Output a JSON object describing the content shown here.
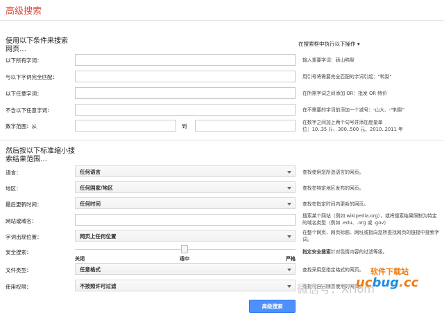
{
  "header": {
    "title": "高级搜索"
  },
  "section1": {
    "title": "使用以下条件来搜索网页…",
    "right_title": "在搜索框中执行以下操作",
    "rows": [
      {
        "label": "以下所有字词：",
        "value": "",
        "hint": "输入重要字词：砀山鸭梨"
      },
      {
        "label": "与以下字词完全匹配：",
        "value": "",
        "hint": "用引号将需要完全匹配的字词引起：\"鸭梨\""
      },
      {
        "label": "以下任意字词：",
        "value": "",
        "hint": "在所需字词之间添加 OR：批发 OR 特价"
      },
      {
        "label": "不含以下任意字词：",
        "value": "",
        "hint": "在不需要的字词前添加一个减号：-山大、-\"刺梨\""
      }
    ],
    "range": {
      "label": "数字范围：从",
      "separator": "到",
      "from_value": "",
      "to_value": "",
      "hint_line1": "在数字之间加上两个句号并添加度量单",
      "hint_line2": "位：10..35 斤、300..500 元、2010..2011 年"
    }
  },
  "section2": {
    "title": "然后按以下标准缩小搜索结果范围…",
    "rows": [
      {
        "label": "语言：",
        "value": "任何语言",
        "hint": "查找使用您所选语言的网页。"
      },
      {
        "label": "地区：",
        "value": "任何国家/地区",
        "hint": "查找在特定地区发布的网页。"
      },
      {
        "label": "最后更新时间：",
        "value": "任何时间",
        "hint": "查找在指定时间内更新的网页。"
      }
    ],
    "site": {
      "label": "网站或域名：",
      "value": "",
      "hint_line1": "搜索某个网站（例如 wikipedia.org），或将搜索结果限制为特定",
      "hint_line2": "的域名类型（例如 .edu、.org 或 .gov）"
    },
    "terms": {
      "label": "字词出现位置：",
      "value": "网页上任何位置",
      "hint_line1": "在整个网页、网页标题、网址或指向您所查找网页的链接中搜索字",
      "hint_line2": "词。"
    },
    "safesearch": {
      "label": "安全搜索：",
      "stops": [
        "关闭",
        "适中",
        "严格"
      ],
      "selected": "适中",
      "hint_bold": "指定安全搜索",
      "hint_rest": "针对色情内容的过滤等级。"
    },
    "filetype": {
      "label": "文件类型：",
      "value": "任意格式",
      "hint": "查找采用您指定格式的网页。"
    },
    "rights": {
      "label": "使用权限：",
      "value": "不按照许可过滤",
      "hint": "查找可自己随意使用的网页。"
    }
  },
  "submit_label": "高级搜索",
  "watermark": {
    "text": "软件下载站",
    "brand_part1": "uc",
    "brand_part2": "bug",
    "brand_part3": ".cc",
    "social": "微信号：XiTom"
  }
}
